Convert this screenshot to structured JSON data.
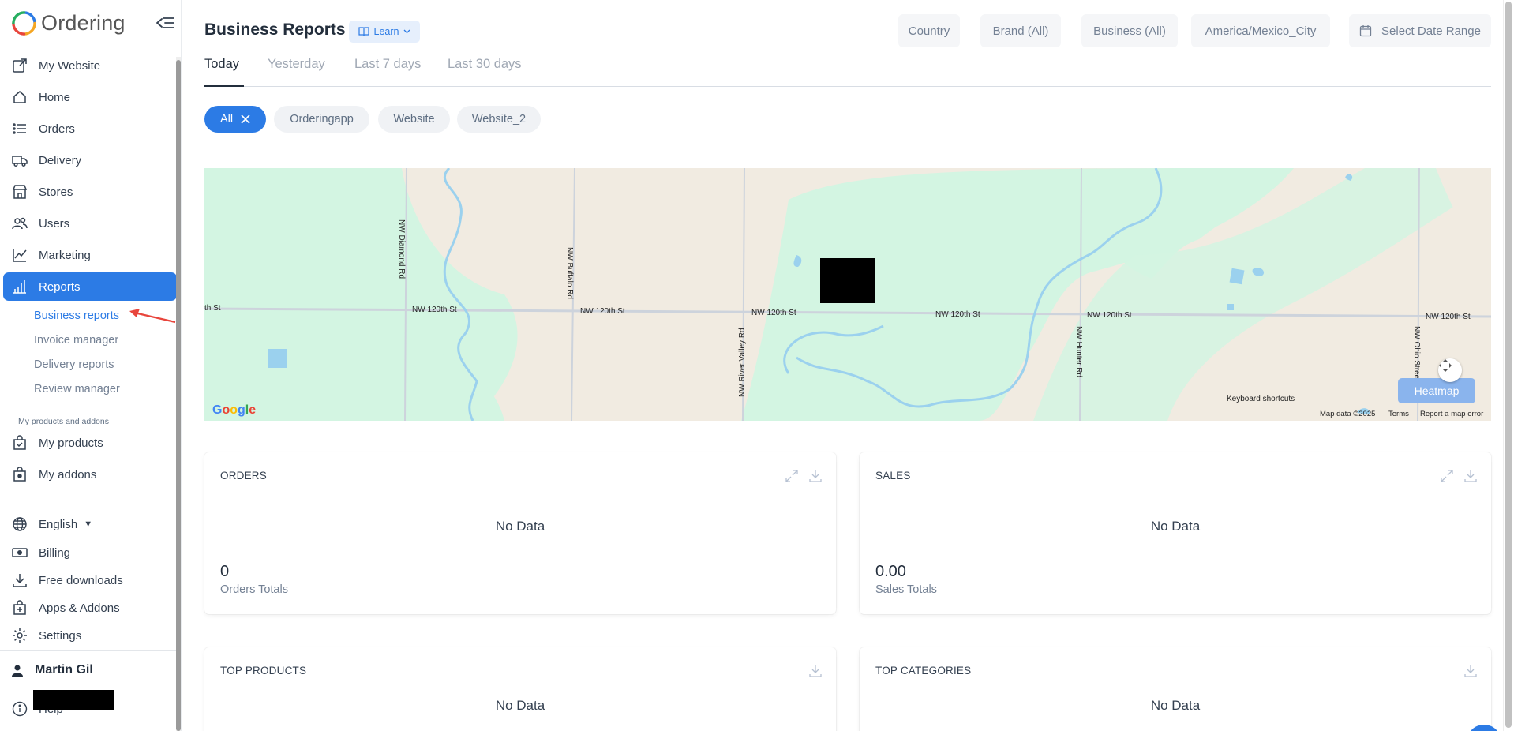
{
  "app": {
    "name": "Ordering"
  },
  "sidebar": {
    "items": [
      {
        "label": "My Website",
        "icon": "external-link-icon"
      },
      {
        "label": "Home",
        "icon": "home-icon"
      },
      {
        "label": "Orders",
        "icon": "list-icon"
      },
      {
        "label": "Delivery",
        "icon": "truck-icon"
      },
      {
        "label": "Stores",
        "icon": "store-icon"
      },
      {
        "label": "Users",
        "icon": "users-icon"
      },
      {
        "label": "Marketing",
        "icon": "trend-icon"
      },
      {
        "label": "Reports",
        "icon": "bar-chart-icon",
        "active": true
      }
    ],
    "report_subitems": [
      {
        "label": "Business reports",
        "active": true
      },
      {
        "label": "Invoice manager"
      },
      {
        "label": "Delivery reports"
      },
      {
        "label": "Review manager"
      }
    ],
    "section_label": "My products and addons",
    "product_items": [
      {
        "label": "My products",
        "icon": "bag-check-icon"
      },
      {
        "label": "My addons",
        "icon": "bag-icon"
      }
    ],
    "footer_items": [
      {
        "label": "English",
        "icon": "globe-icon"
      },
      {
        "label": "Billing",
        "icon": "cash-icon"
      },
      {
        "label": "Free downloads",
        "icon": "download-icon"
      },
      {
        "label": "Apps & Addons",
        "icon": "bag-plus-icon"
      },
      {
        "label": "Settings",
        "icon": "gear-icon"
      }
    ],
    "user_name": "Martin Gil",
    "help_label": "Help"
  },
  "header": {
    "title": "Business Reports",
    "learn_label": "Learn",
    "filters": [
      "Country",
      "Brand (All)",
      "Business (All)",
      "America/Mexico_City",
      "Select Date Range"
    ]
  },
  "tabs": [
    "Today",
    "Yesterday",
    "Last 7 days",
    "Last 30 days"
  ],
  "chips": [
    "All",
    "Orderingapp",
    "Website",
    "Website_2"
  ],
  "map": {
    "streets": [
      "NW 120th St",
      "NW Diamond Rd",
      "NW Buffalo Rd",
      "NW River Valley Rd",
      "NW Hunter Rd",
      "NW Ohio Street Rd"
    ],
    "heatmap_label": "Heatmap",
    "keyboard_shortcuts": "Keyboard shortcuts",
    "map_data": "Map data ©2025",
    "terms": "Terms",
    "report_error": "Report a map error",
    "google": "Google"
  },
  "cards": {
    "orders": {
      "title": "ORDERS",
      "no_data": "No Data",
      "total": "0",
      "total_label": "Orders Totals"
    },
    "sales": {
      "title": "SALES",
      "no_data": "No Data",
      "total": "0.00",
      "total_label": "Sales Totals"
    },
    "top_products": {
      "title": "TOP PRODUCTS",
      "no_data": "No Data"
    },
    "top_categories": {
      "title": "TOP CATEGORIES",
      "no_data": "No Data"
    }
  },
  "colors": {
    "accent": "#2c7be5",
    "annotation_arrow": "#e8453c",
    "park": "#d3f5e2",
    "land": "#f1ebe1",
    "water": "#9bd1ee"
  }
}
